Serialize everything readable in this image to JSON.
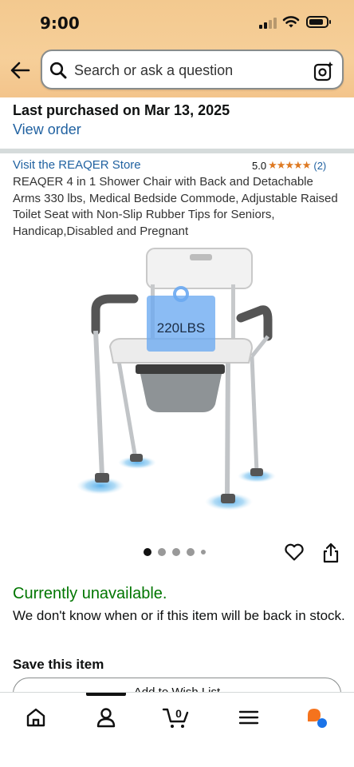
{
  "status_bar": {
    "time": "9:00"
  },
  "header": {
    "search_placeholder": "Search or ask a question"
  },
  "purchase": {
    "title": "Last purchased on Mar 13, 2025",
    "view_order_label": "View order"
  },
  "product": {
    "store_link": "Visit the REAQER Store",
    "rating_value": "5.0",
    "stars": "★★★★★",
    "rating_count": "(2)",
    "title": "REAQER 4 in 1 Shower Chair with Back and Detachable Arms 330 lbs, Medical Bedside Commode, Adjustable Raised Toilet Seat with Non-Slip Rubber Tips for Seniors, Handicap,Disabled and Pregnant",
    "image_weight_label": "220LBS",
    "image_count": 5,
    "active_image_index": 0
  },
  "availability": {
    "status": "Currently unavailable.",
    "message": "We don't know when or if this item will be back in stock."
  },
  "save": {
    "title": "Save this item",
    "wish_list_label": "Add to Wish List"
  },
  "bottom_nav": {
    "items": [
      "home-icon",
      "account-icon",
      "cart-icon",
      "menu-icon",
      "rufus-icon"
    ],
    "cart_count": "0",
    "active_item": "account-icon"
  },
  "colors": {
    "header_gradient": "#f3c98f",
    "link": "#2162a1",
    "stars": "#de7921",
    "unavailable": "#007600"
  }
}
